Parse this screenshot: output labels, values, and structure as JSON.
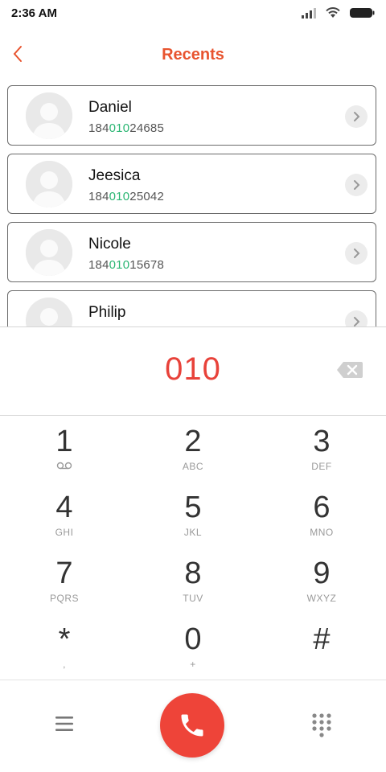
{
  "status": {
    "time": "2:36 AM",
    "icons": [
      "signal-icon",
      "wifi-icon",
      "battery-icon"
    ]
  },
  "header": {
    "title": "Recents",
    "back_icon": "chevron-left-icon"
  },
  "contacts": [
    {
      "name": "Daniel",
      "number_prefix": "184",
      "number_match": "010",
      "number_suffix": "24685"
    },
    {
      "name": "Jeesica",
      "number_prefix": "184",
      "number_match": "010",
      "number_suffix": "25042"
    },
    {
      "name": "Nicole",
      "number_prefix": "184",
      "number_match": "010",
      "number_suffix": "15678"
    },
    {
      "name": "Philip",
      "number_prefix": "",
      "number_match": "",
      "number_suffix": ""
    }
  ],
  "dial": {
    "entered": "010",
    "backspace_icon": "backspace-icon"
  },
  "keypad": [
    {
      "digit": "1",
      "letters": "voicemail"
    },
    {
      "digit": "2",
      "letters": "ABC"
    },
    {
      "digit": "3",
      "letters": "DEF"
    },
    {
      "digit": "4",
      "letters": "GHI"
    },
    {
      "digit": "5",
      "letters": "JKL"
    },
    {
      "digit": "6",
      "letters": "MNO"
    },
    {
      "digit": "7",
      "letters": "PQRS"
    },
    {
      "digit": "8",
      "letters": "TUV"
    },
    {
      "digit": "9",
      "letters": "WXYZ"
    },
    {
      "digit": "*",
      "letters": ","
    },
    {
      "digit": "0",
      "letters": "+"
    },
    {
      "digit": "#",
      "letters": ""
    }
  ],
  "bottom": {
    "menu_icon": "menu-icon",
    "call_icon": "phone-icon",
    "keypad_icon": "dialpad-icon"
  },
  "colors": {
    "accent": "#e8542f",
    "call": "#ee4439",
    "match": "#2bb673"
  }
}
